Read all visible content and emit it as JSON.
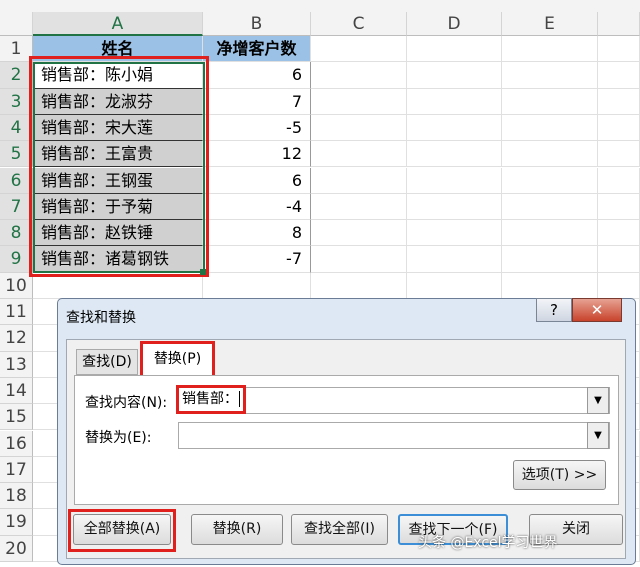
{
  "columns": [
    "A",
    "B",
    "C",
    "D",
    "E"
  ],
  "rows": [
    "1",
    "2",
    "3",
    "4",
    "5",
    "6",
    "7",
    "8",
    "9",
    "10",
    "11",
    "12",
    "13",
    "14",
    "15",
    "16",
    "17",
    "18",
    "19",
    "20"
  ],
  "headers": {
    "a": "姓名",
    "b": "净增客户数"
  },
  "data": [
    {
      "name": "销售部：陈小娟",
      "value": "6"
    },
    {
      "name": "销售部：龙淑芬",
      "value": "7"
    },
    {
      "name": "销售部：宋大莲",
      "value": "-5"
    },
    {
      "name": "销售部：王富贵",
      "value": "12"
    },
    {
      "name": "销售部：王钢蛋",
      "value": "6"
    },
    {
      "name": "销售部：于予菊",
      "value": "-4"
    },
    {
      "name": "销售部：赵铁锤",
      "value": "8"
    },
    {
      "name": "销售部：诸葛钢铁",
      "value": "-7"
    }
  ],
  "dialog": {
    "title": "查找和替换",
    "help": "?",
    "close": "✕",
    "tabs": [
      "查找(D)",
      "替换(P)"
    ],
    "find_label": "查找内容(N):",
    "find_value": "销售部：",
    "replace_label": "替换为(E):",
    "replace_value": "",
    "options": "选项(T) >>",
    "buttons": [
      "全部替换(A)",
      "替换(R)",
      "查找全部(I)",
      "查找下一个(F)",
      "关闭"
    ]
  },
  "watermark": "头条 @Excel学习世界"
}
